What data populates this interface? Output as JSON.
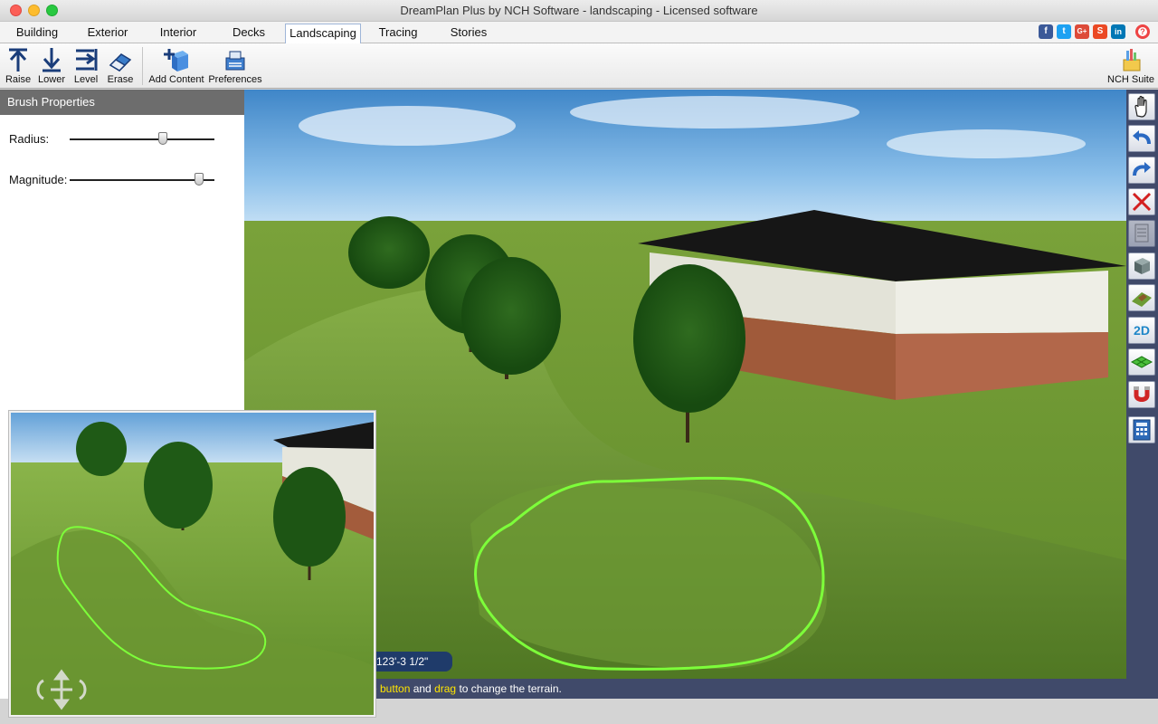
{
  "window": {
    "title": "DreamPlan Plus by NCH Software - landscaping - Licensed software"
  },
  "tabs": [
    "Building",
    "Exterior",
    "Interior",
    "Decks",
    "Landscaping",
    "Tracing",
    "Stories"
  ],
  "active_tab": "Landscaping",
  "social": [
    "f",
    "t",
    "G+",
    "S",
    "in",
    "?"
  ],
  "toolbar": {
    "raise": "Raise",
    "lower": "Lower",
    "level": "Level",
    "erase": "Erase",
    "add_content": "Add Content",
    "preferences": "Preferences",
    "nch_suite": "NCH Suite"
  },
  "panel": {
    "title": "Brush Properties",
    "radius_label": "Radius:",
    "radius_value": 0.65,
    "magnitude_label": "Magnitude:",
    "magnitude_value": 0.92
  },
  "viewport": {
    "coordinate": "123'-3 1/2\"",
    "status_prefix": "e button",
    "status_and": " and ",
    "status_drag": "drag",
    "status_suffix": " to change the terrain."
  },
  "right_tools": [
    "hand-icon",
    "undo-icon",
    "redo-icon",
    "delete-icon",
    "copy-icon",
    "box-icon",
    "terrain-icon",
    "2d-view",
    "grid-icon",
    "magnet-icon",
    "calculator-icon"
  ],
  "right_tools_2d_label": "2D",
  "colors": {
    "accent_blue": "#1f3b6a",
    "status_bar": "#404a6a",
    "brush_outline": "#7dff3a"
  }
}
